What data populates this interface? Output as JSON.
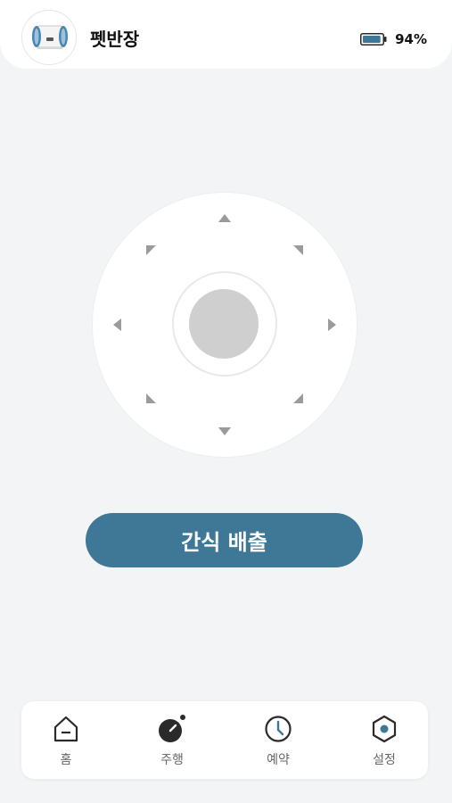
{
  "header": {
    "device_name": "펫반장",
    "battery_percent": "94%",
    "battery_level": 0.94
  },
  "icons": {
    "avatar": "pet-robot-icon",
    "battery": "battery-icon"
  },
  "joystick": {
    "directions": [
      "up",
      "up-right",
      "right",
      "down-right",
      "down",
      "down-left",
      "left",
      "up-left"
    ]
  },
  "action": {
    "treat_label": "간식 배출"
  },
  "colors": {
    "accent": "#3e7896",
    "background": "#f3f4f6",
    "knob": "#cfcfcf",
    "arrow": "#9b9b9b"
  },
  "nav": {
    "items": [
      {
        "label": "홈",
        "icon": "home-icon"
      },
      {
        "label": "주행",
        "icon": "drive-icon"
      },
      {
        "label": "예약",
        "icon": "clock-icon"
      },
      {
        "label": "설정",
        "icon": "settings-icon"
      }
    ]
  }
}
